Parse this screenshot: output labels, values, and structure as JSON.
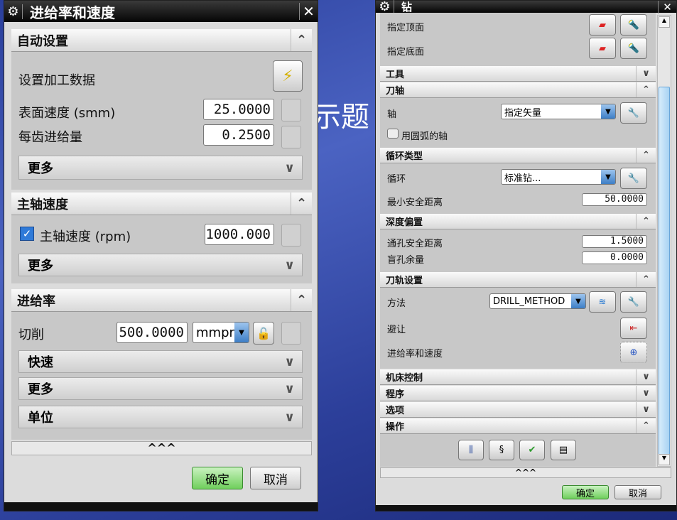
{
  "background": {
    "slide_title": "示题"
  },
  "left": {
    "title": "进给率和速度",
    "auto": {
      "header": "自动设置",
      "set_data": "设置加工数据",
      "surface_speed_label": "表面速度 (smm)",
      "surface_speed": "25.0000",
      "feed_per_tooth_label": "每齿进给量",
      "feed_per_tooth": "0.2500",
      "more": "更多"
    },
    "spindle": {
      "header": "主轴速度",
      "spindle_label": "主轴速度 (rpm)",
      "spindle_checked": true,
      "spindle_value": "1000.000",
      "more": "更多"
    },
    "feed": {
      "header": "进给率",
      "cut_label": "切削",
      "cut_value": "500.0000",
      "unit": "mmpr",
      "rapid": "快速",
      "more": "更多",
      "units": "单位"
    },
    "expand": "^^^",
    "ok": "确定",
    "cancel": "取消"
  },
  "right": {
    "title": "钻",
    "top_face": "指定顶面",
    "bottom_face": "指定底面",
    "sections": {
      "tool": "工具",
      "tool_axis": "刀轴",
      "cycle_type": "循环类型",
      "depth_offset": "深度偏置",
      "path_settings": "刀轨设置",
      "machine_control": "机床控制",
      "program": "程序",
      "options": "选项",
      "actions": "操作"
    },
    "axis_label": "轴",
    "axis_value": "指定矢量",
    "arc_axis": "用圆弧的轴",
    "cycle_label": "循环",
    "cycle_value": "标准钻...",
    "min_clearance_label": "最小安全距离",
    "min_clearance": "50.0000",
    "through_clearance_label": "通孔安全距离",
    "through_clearance": "1.5000",
    "blind_stock_label": "盲孔余量",
    "blind_stock": "0.0000",
    "method_label": "方法",
    "method_value": "DRILL_METHOD",
    "avoid_label": "避让",
    "feeds_label": "进给率和速度",
    "expand": "^^^",
    "ok": "确定",
    "cancel": "取消"
  }
}
